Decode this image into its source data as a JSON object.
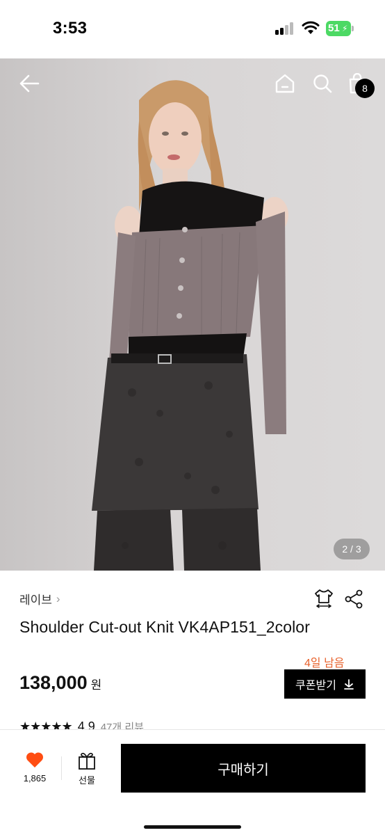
{
  "status_bar": {
    "time": "3:53",
    "battery_percent": "51",
    "battery_color": "#4cd964",
    "icons": [
      "signal-icon",
      "wifi-icon",
      "battery-icon"
    ]
  },
  "hero": {
    "page_indicator": "2 / 3",
    "cart_count": "8",
    "icons": [
      "back-arrow-icon",
      "home-icon",
      "search-icon",
      "shopping-bag-icon"
    ]
  },
  "product": {
    "brand": "레이브",
    "brand_chevron": "›",
    "title": "Shoulder Cut-out Knit VK4AP151_2color",
    "coupon_days_left": "4일 남음",
    "price": "138,000",
    "price_unit": "원",
    "coupon_button": "쿠폰받기",
    "rating_stars": "★★★★★",
    "rating_score": "4.9",
    "review_count": "47개 리뷰"
  },
  "bottom_bar": {
    "like_count": "1,865",
    "gift_label": "선물",
    "buy_label": "구매하기",
    "like_color": "#ff4d12"
  }
}
